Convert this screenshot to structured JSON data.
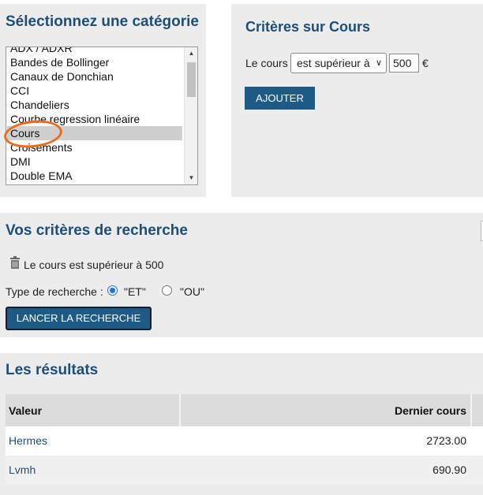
{
  "category": {
    "title": "Sélectionnez une catégorie",
    "items": [
      "ADX / ADXR",
      "Bandes de Bollinger",
      "Canaux de Donchian",
      "CCI",
      "Chandeliers",
      "Courbe regression linéaire",
      "Cours",
      "Croisements",
      "DMI",
      "Double EMA"
    ],
    "selected": "Cours",
    "annotation_color": "#f06a1e"
  },
  "criteria": {
    "title": "Critères sur Cours",
    "label": "Le cours",
    "operator": "est supérieur à",
    "value": "500",
    "unit": "€",
    "add_button": "AJOUTER"
  },
  "search": {
    "title": "Vos critères de recherche",
    "criteria_items": [
      "Le cours est supérieur à 500"
    ],
    "type_label": "Type de recherche :",
    "option_et": "\"ET\"",
    "option_ou": "\"OU\"",
    "selected_option": "ET",
    "launch_button": "LANCER LA RECHERCHE"
  },
  "results": {
    "title": "Les résultats",
    "columns": [
      "Valeur",
      "Dernier cours"
    ],
    "rows": [
      {
        "valeur": "Hermes",
        "dernier_cours": "2723.00"
      },
      {
        "valeur": "Lvmh",
        "dernier_cours": "690.90"
      }
    ]
  },
  "colors": {
    "heading": "#1d4e79",
    "button": "#1e5a86",
    "panel": "#ececec"
  }
}
